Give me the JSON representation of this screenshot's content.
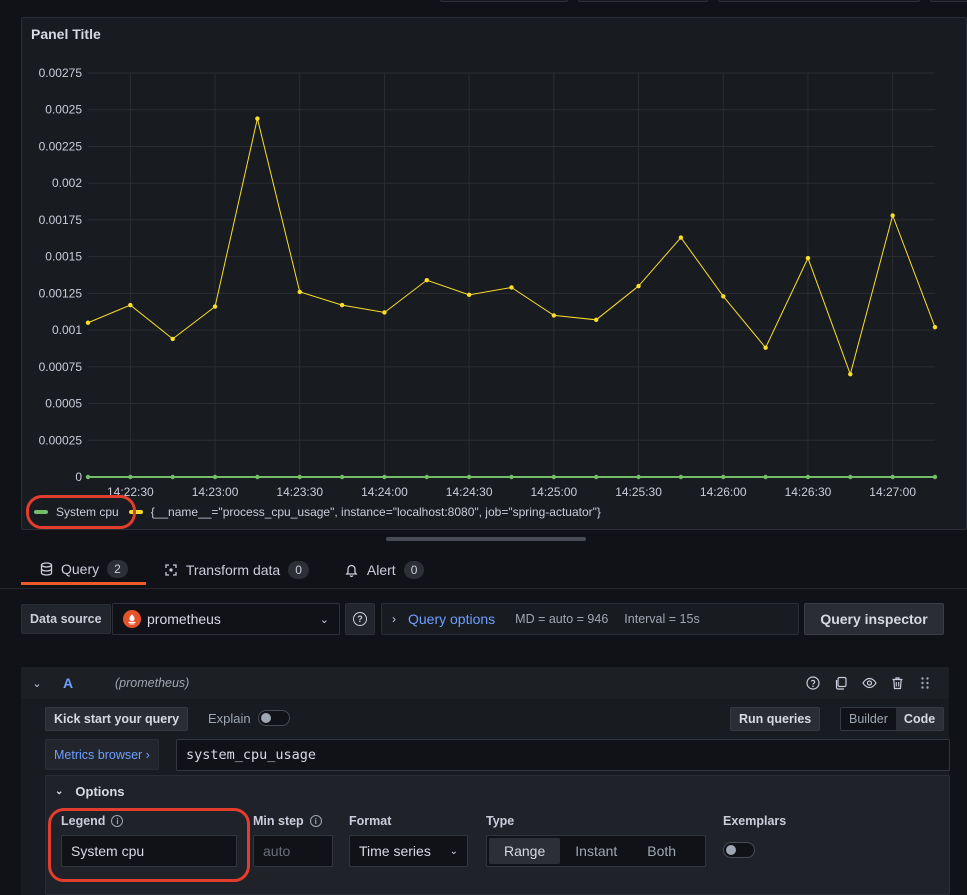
{
  "panel": {
    "title": "Panel Title"
  },
  "chart_data": {
    "type": "line",
    "title": "Panel Title",
    "x": [
      "14:22:15",
      "14:22:30",
      "14:22:45",
      "14:23:00",
      "14:23:15",
      "14:23:30",
      "14:23:45",
      "14:24:00",
      "14:24:15",
      "14:24:30",
      "14:24:45",
      "14:25:00",
      "14:25:15",
      "14:25:30",
      "14:25:45",
      "14:26:00",
      "14:26:15",
      "14:26:30",
      "14:26:45",
      "14:27:00",
      "14:27:15"
    ],
    "x_ticks": [
      "14:22:30",
      "14:23:00",
      "14:23:30",
      "14:24:00",
      "14:24:30",
      "14:25:00",
      "14:25:30",
      "14:26:00",
      "14:26:30",
      "14:27:00"
    ],
    "y_ticks": [
      "0",
      "0.00025",
      "0.0005",
      "0.00075",
      "0.001",
      "0.00125",
      "0.0015",
      "0.00175",
      "0.002",
      "0.00225",
      "0.0025",
      "0.00275"
    ],
    "ylim": [
      0,
      0.00275
    ],
    "grid": true,
    "legend_position": "bottom-left",
    "series": [
      {
        "name": "System cpu",
        "color": "#73bf69",
        "values": [
          0,
          0,
          0,
          0,
          0,
          0,
          0,
          0,
          0,
          0,
          0,
          0,
          0,
          0,
          0,
          0,
          0,
          0,
          0,
          0,
          0
        ]
      },
      {
        "name": "{__name__=\"process_cpu_usage\", instance=\"localhost:8080\", job=\"spring-actuator\"}",
        "color": "#fade2a",
        "values": [
          0.00105,
          0.00117,
          0.00094,
          0.00116,
          0.00244,
          0.00126,
          0.00117,
          0.00112,
          0.00134,
          0.00124,
          0.00129,
          0.0011,
          0.00107,
          0.0013,
          0.00163,
          0.00123,
          0.00088,
          0.00149,
          0.0007,
          0.00178,
          0.00102
        ]
      }
    ]
  },
  "tabs": [
    {
      "label": "Query",
      "count": "2",
      "icon": "database-icon"
    },
    {
      "label": "Transform data",
      "count": "0",
      "icon": "transform-icon"
    },
    {
      "label": "Alert",
      "count": "0",
      "icon": "bell-icon"
    }
  ],
  "datasource": {
    "label": "Data source",
    "selected": "prometheus"
  },
  "query_options": {
    "link": "Query options",
    "md": "MD = auto = 946",
    "interval": "Interval = 15s"
  },
  "query_inspector": "Query inspector",
  "query_row": {
    "ref_id": "A",
    "datasource": "(prometheus)"
  },
  "toolbar": {
    "kick_start": "Kick start your query",
    "explain": "Explain",
    "run_queries": "Run queries",
    "builder": "Builder",
    "code": "Code"
  },
  "metrics_browser": "Metrics browser ›",
  "query_expr": "system_cpu_usage",
  "options": {
    "header": "Options",
    "legend_label": "Legend",
    "legend_value": "System cpu",
    "min_step_label": "Min step",
    "min_step_placeholder": "auto",
    "format_label": "Format",
    "format_value": "Time series",
    "type_label": "Type",
    "type_options": [
      "Range",
      "Instant",
      "Both"
    ],
    "exemplars_label": "Exemplars"
  }
}
